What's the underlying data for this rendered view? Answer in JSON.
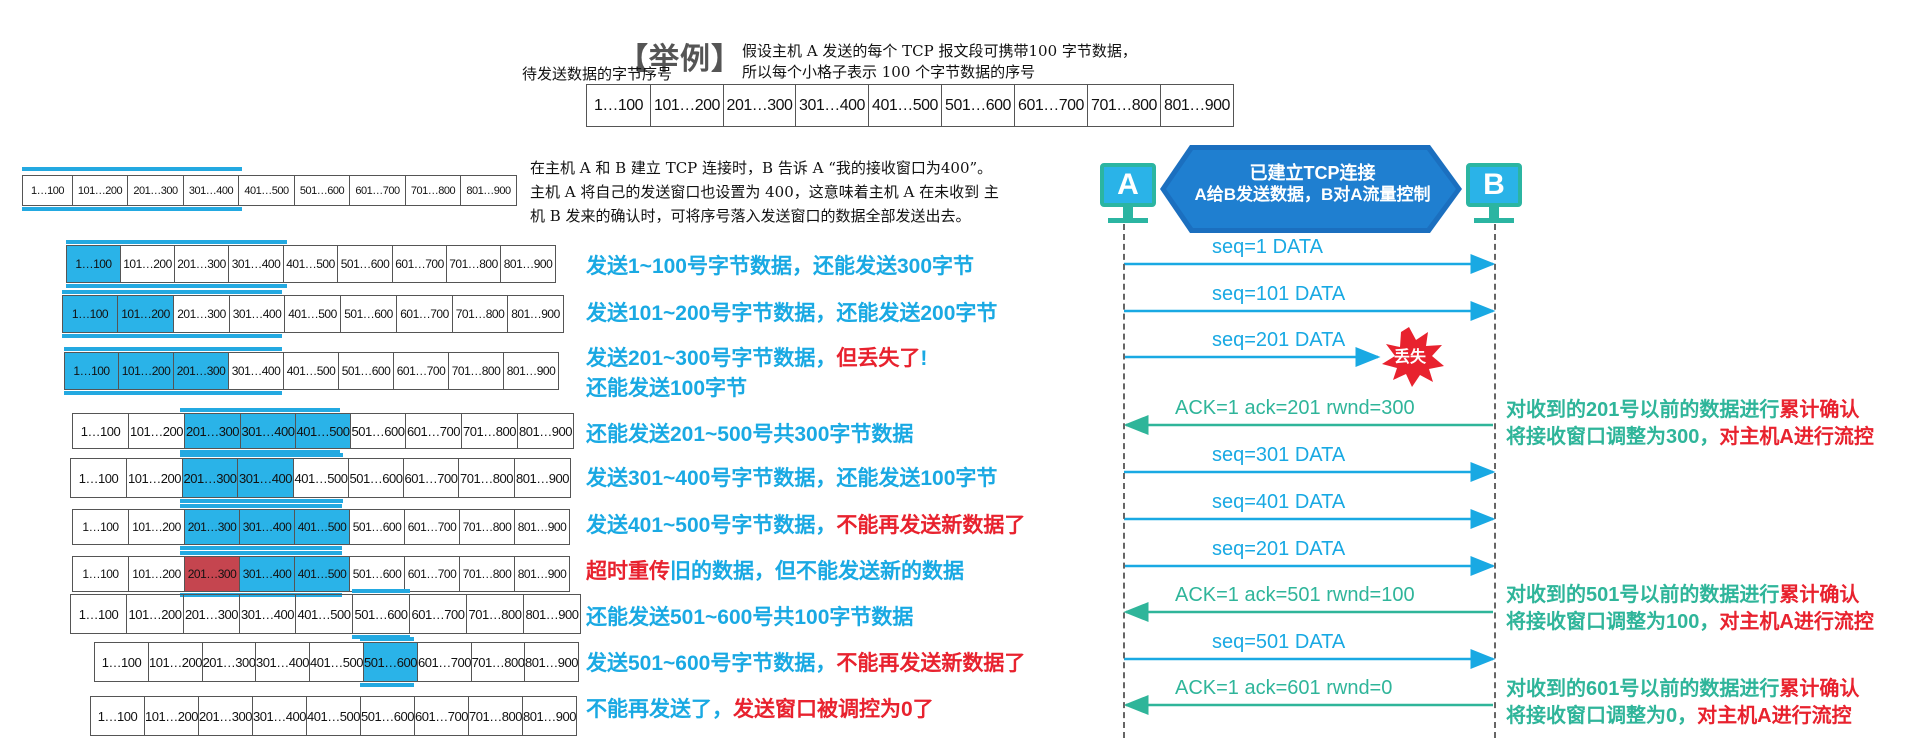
{
  "header": {
    "example_tag": "【举例】",
    "note_line1": "假设主机 A 发送的每个 TCP 报文段可携带100 字节数据，",
    "note_line2": "所以每个小格子表示 100 个字节数据的序号",
    "bytes_label": "待发送数据的字节序号"
  },
  "segments": [
    "1…100",
    "101…200",
    "201…300",
    "301…400",
    "401…500",
    "501…600",
    "601…700",
    "701…800",
    "801…900"
  ],
  "intro": {
    "line1": "在主机 A 和 B 建立 TCP 连接时，B 告诉 A “我的接收窗口为400”。",
    "line2": "主机 A 将自己的发送窗口也设置为 400，这意味着主机 A 在未收到 主",
    "line3": "机  B 发来的确认时，可将序号落入发送窗口的数据全部发送出去。"
  },
  "rows": [
    {
      "parts": [
        {
          "text": "发送1~100号字节数据，还能发送300字节",
          "color": "blue"
        }
      ]
    },
    {
      "parts": [
        {
          "text": "发送101~200号字节数据，还能发送200字节",
          "color": "blue"
        }
      ]
    },
    {
      "parts": [
        {
          "text": "发送201~300号字节数据，",
          "color": "blue"
        },
        {
          "text": "但丢失了",
          "color": "red"
        },
        {
          "text": "!",
          "color": "blue"
        }
      ],
      "line2": "还能发送100字节"
    },
    {
      "parts": [
        {
          "text": "还能发送201~500号共300字节数据",
          "color": "blue"
        }
      ]
    },
    {
      "parts": [
        {
          "text": "发送301~400号字节数据，还能发送100字节",
          "color": "blue"
        }
      ]
    },
    {
      "parts": [
        {
          "text": "发送401~500号字节数据，",
          "color": "blue"
        },
        {
          "text": "不能再发送新数据了",
          "color": "red"
        }
      ]
    },
    {
      "parts": [
        {
          "text": "超时重传",
          "color": "red"
        },
        {
          "text": "旧的数据，但不能发送新的数据",
          "color": "blue"
        }
      ]
    },
    {
      "parts": [
        {
          "text": "还能发送501~600号共100字节数据",
          "color": "blue"
        }
      ]
    },
    {
      "parts": [
        {
          "text": "发送501~600号字节数据，",
          "color": "blue"
        },
        {
          "text": "不能再发送新数据了",
          "color": "red"
        }
      ]
    },
    {
      "parts": [
        {
          "text": "不能再发送了，",
          "color": "blue"
        },
        {
          "text": "发送窗口被调控为0了",
          "color": "red"
        }
      ]
    }
  ],
  "timeline": {
    "host_a": "A",
    "host_b": "B",
    "banner_line1": "已建立TCP连接",
    "banner_line2": "A给B发送数据，B对A流量控制",
    "lost_label": "丢失",
    "messages": [
      {
        "dir": "fwd",
        "label": "seq=1   DATA"
      },
      {
        "dir": "fwd",
        "label": "seq=101   DATA"
      },
      {
        "dir": "fwd",
        "label": "seq=201   DATA",
        "lost": true
      },
      {
        "dir": "ack",
        "label": "ACK=1   ack=201   rwnd=300"
      },
      {
        "dir": "fwd",
        "label": "seq=301   DATA"
      },
      {
        "dir": "fwd",
        "label": "seq=401   DATA"
      },
      {
        "dir": "fwd",
        "label": "seq=201   DATA"
      },
      {
        "dir": "ack",
        "label": "ACK=1   ack=501   rwnd=100"
      },
      {
        "dir": "fwd",
        "label": "seq=501   DATA"
      },
      {
        "dir": "ack",
        "label": "ACK=1   ack=601   rwnd=0"
      }
    ],
    "notes": [
      {
        "l1a": "对收到的201号以前的数据进行",
        "l1b": "累计确认",
        "l2a": "将接收窗口调整为300，",
        "l2b": "对主机A进行流控"
      },
      {
        "l1a": "对收到的501号以前的数据进行",
        "l1b": "累计确认",
        "l2a": "将接收窗口调整为100，",
        "l2b": "对主机A进行流控"
      },
      {
        "l1a": "对收到的601号以前的数据进行",
        "l1b": "累计确认",
        "l2a": "将接收窗口调整为0，",
        "l2b": "对主机A进行流控"
      }
    ]
  },
  "colors": {
    "blue": "#19a9e3",
    "red": "#e8222e",
    "green": "#2fb59a",
    "window": "#2ab3e8",
    "lost_cell": "#c5454f"
  }
}
